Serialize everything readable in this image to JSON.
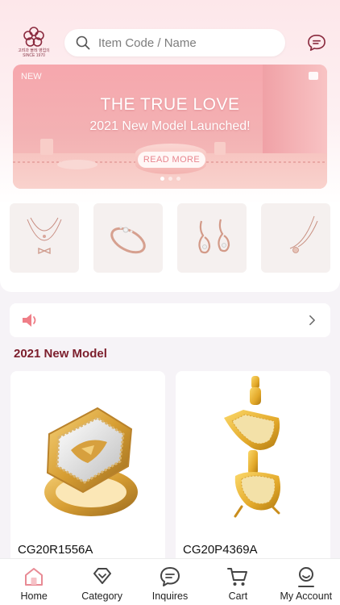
{
  "header": {
    "logo_text_line1": "고려과 블레 영업의",
    "logo_text_line2": "SINCE 1970",
    "search": {
      "placeholder": "Item Code / Name"
    },
    "chat_icon": "chat-bubble-icon"
  },
  "banner": {
    "tag": "NEW",
    "title": "THE TRUE LOVE",
    "subtitle": "2021 New Model Launched!",
    "button": "READ MORE",
    "slide_count": 3,
    "active_slide": 1
  },
  "categories": [
    {
      "name": "necklace-double",
      "icon": "necklace-bow-icon"
    },
    {
      "name": "ring",
      "icon": "ring-icon"
    },
    {
      "name": "earrings",
      "icon": "earrings-icon"
    },
    {
      "name": "necklace-single",
      "icon": "necklace-pendant-icon"
    }
  ],
  "notice": {
    "icon": "speaker-icon",
    "arrow": "chevron-right-icon"
  },
  "section": {
    "title": "2021 New Model"
  },
  "products": [
    {
      "code": "CG20R1556A",
      "image": "gold-ring"
    },
    {
      "code": "CG20P4369A",
      "image": "sunglasses-pendant"
    }
  ],
  "nav": {
    "items": [
      {
        "label": "Home",
        "icon": "home-icon",
        "active": true
      },
      {
        "label": "Category",
        "icon": "diamond-icon"
      },
      {
        "label": "Inquires",
        "icon": "chat-icon"
      },
      {
        "label": "Cart",
        "icon": "cart-icon"
      },
      {
        "label": "My Account",
        "icon": "user-icon"
      }
    ]
  },
  "colors": {
    "accent": "#7c1e2c",
    "banner_pink": "#f4acb0",
    "nav_active": "#e88a94"
  }
}
